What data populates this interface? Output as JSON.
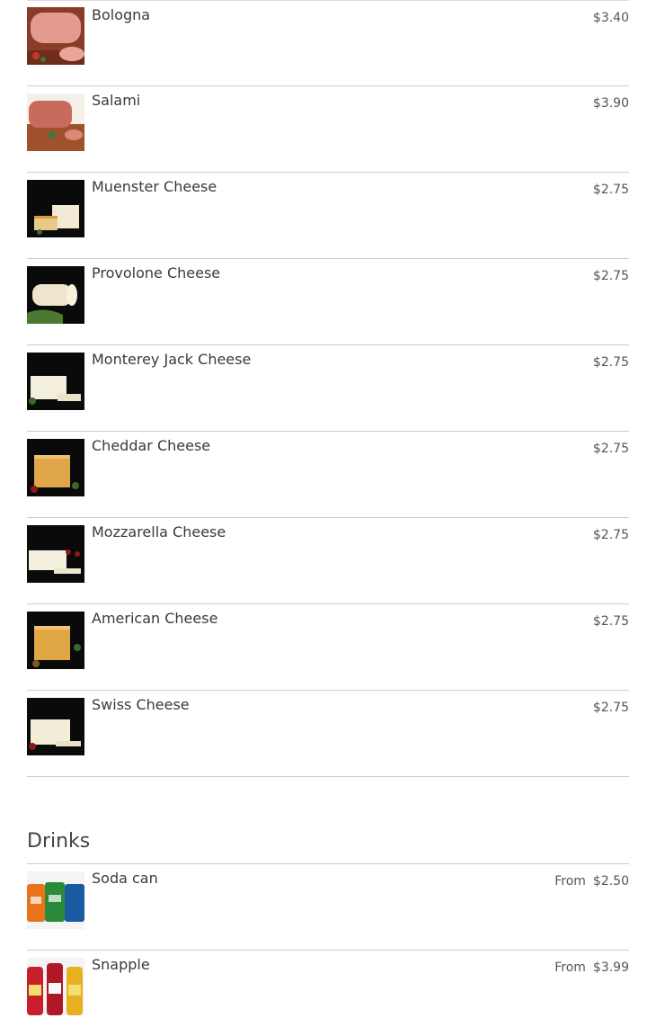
{
  "menu": {
    "items": [
      {
        "name": "Bologna",
        "price": "$3.40",
        "icon": "bologna-photo"
      },
      {
        "name": "Salami",
        "price": "$3.90",
        "icon": "salami-photo"
      },
      {
        "name": "Muenster Cheese",
        "price": "$2.75",
        "icon": "muenster-cheese-photo"
      },
      {
        "name": "Provolone Cheese",
        "price": "$2.75",
        "icon": "provolone-cheese-photo"
      },
      {
        "name": "Monterey Jack Cheese",
        "price": "$2.75",
        "icon": "monterey-jack-cheese-photo"
      },
      {
        "name": "Cheddar Cheese",
        "price": "$2.75",
        "icon": "cheddar-cheese-photo"
      },
      {
        "name": "Mozzarella Cheese",
        "price": "$2.75",
        "icon": "mozzarella-cheese-photo"
      },
      {
        "name": "American Cheese",
        "price": "$2.75",
        "icon": "american-cheese-photo"
      },
      {
        "name": "Swiss Cheese",
        "price": "$2.75",
        "icon": "swiss-cheese-photo"
      }
    ],
    "drinks": {
      "title": "Drinks",
      "items": [
        {
          "name": "Soda can",
          "from": "From",
          "price": "$2.50",
          "icon": "soda-cans-photo"
        },
        {
          "name": "Snapple",
          "from": "From",
          "price": "$3.99",
          "icon": "snapple-bottles-photo"
        }
      ]
    }
  },
  "colors": {
    "text": "#3a3a3a",
    "price": "#555555",
    "divider": "#cccccc"
  }
}
